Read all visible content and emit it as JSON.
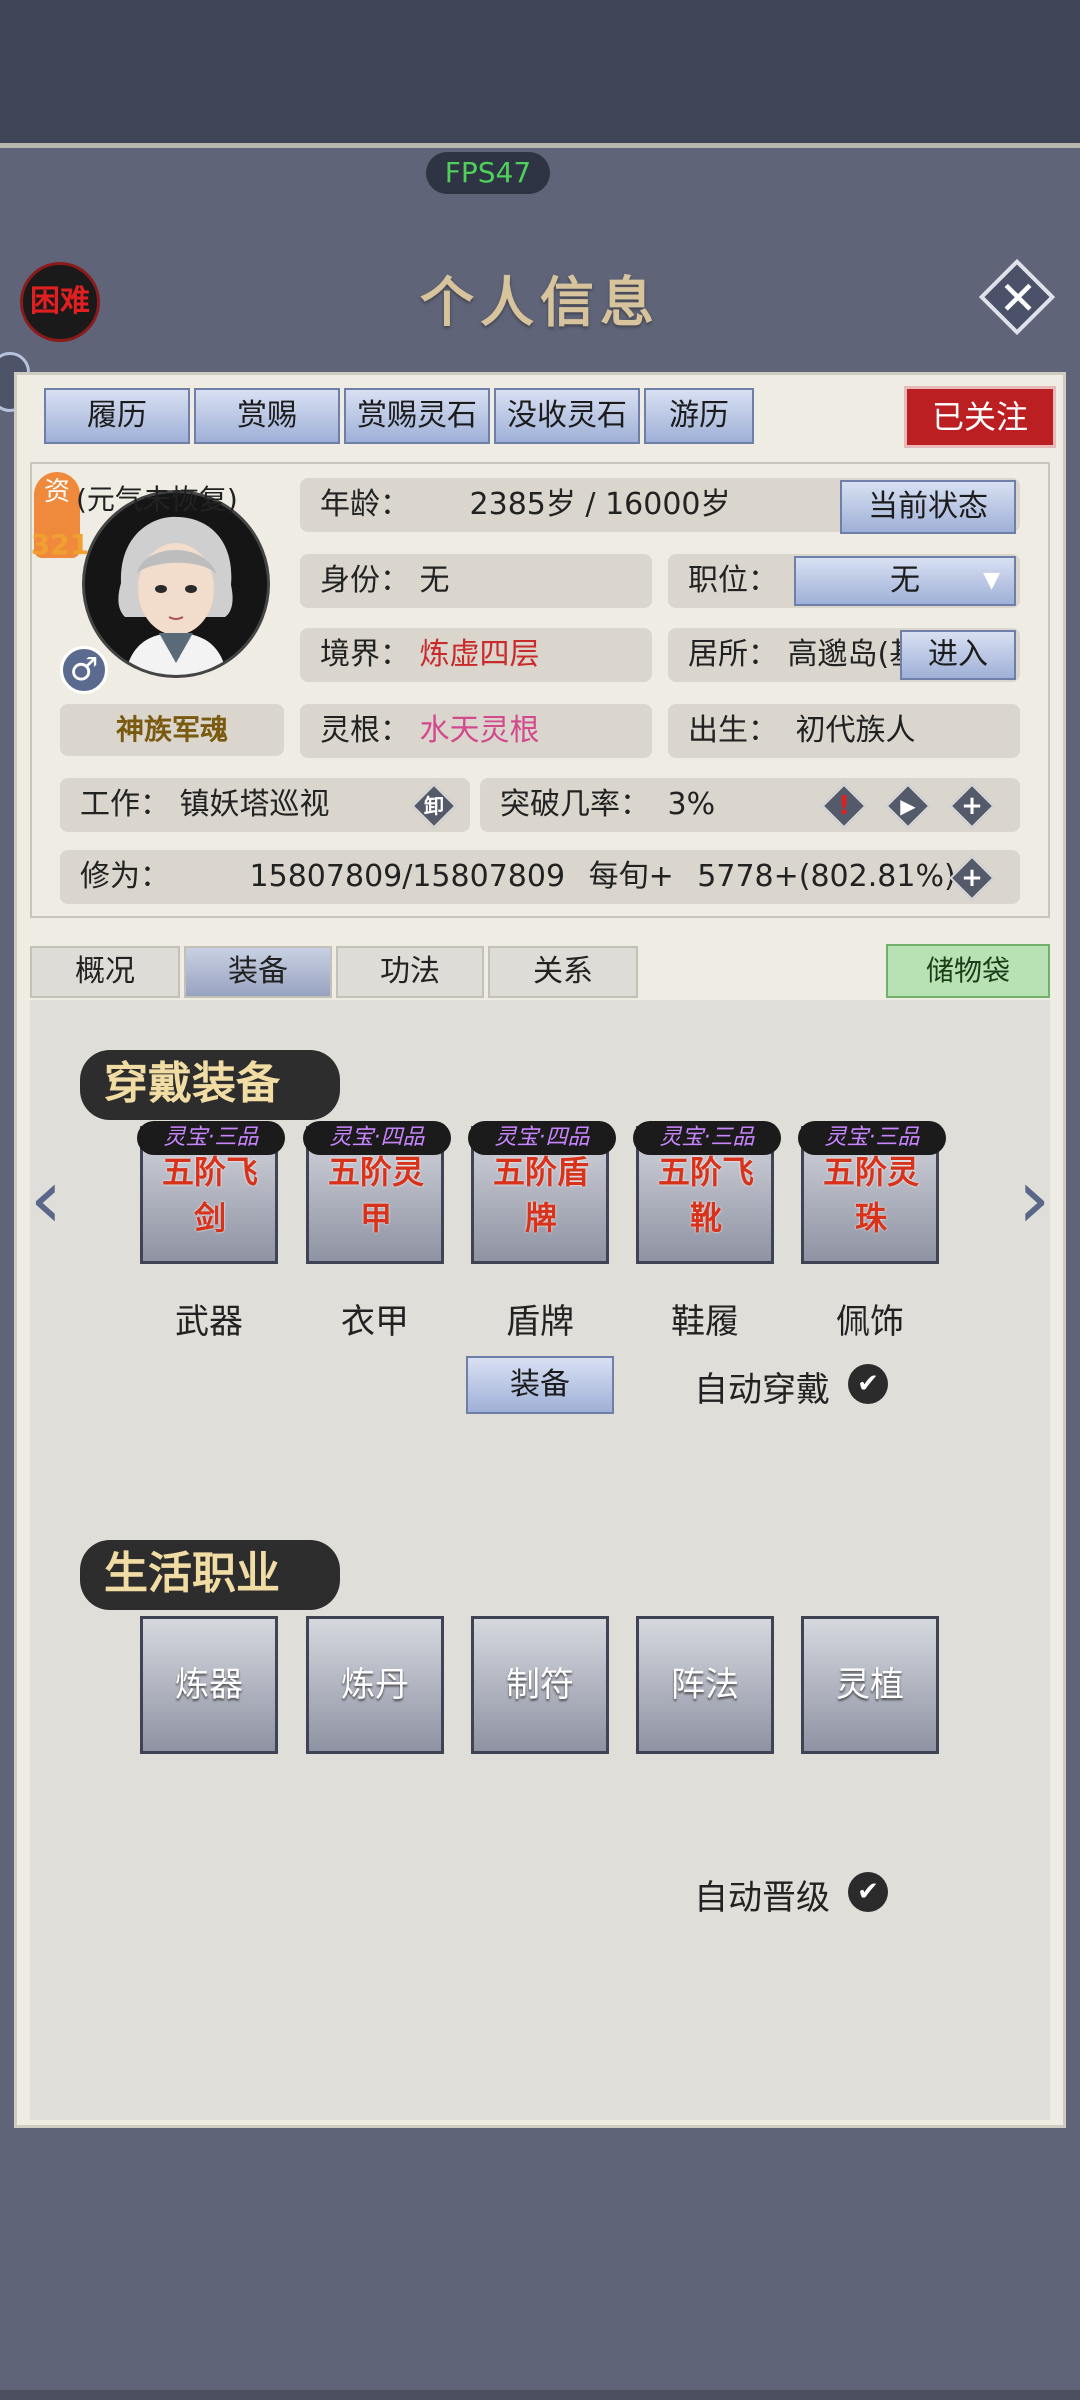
{
  "hud": {
    "fps": "FPS47"
  },
  "header": {
    "difficulty": "困难",
    "title": "个人信息",
    "close_icon": "close-icon"
  },
  "top_nav": {
    "tabs": [
      "履历",
      "赏赐",
      "赏赐灵石",
      "没收灵石",
      "游历"
    ],
    "followed": "已关注"
  },
  "profile": {
    "aptitude_label": "资",
    "aptitude_value": "321",
    "vigor_status": "(元气未恢复)",
    "gender_icon": "♂",
    "title_badge": "神族军魂",
    "age_label": "年龄：",
    "age_value": "2385岁 / 16000岁",
    "current_state_button": "当前状态",
    "identity_label": "身份：",
    "identity_value": "无",
    "position_label": "职位：",
    "position_value": "无",
    "realm_label": "境界：",
    "realm_value": "炼虚四层",
    "residence_label": "居所：",
    "residence_value": "高邈岛(基",
    "enter_button": "进入",
    "root_label": "灵根：",
    "root_value": "水天灵根",
    "birth_label": "出生：",
    "birth_value": "初代族人",
    "work_label": "工作：",
    "work_value": "镇妖塔巡视",
    "work_button": "卸",
    "breakthrough_label": "突破几率：",
    "breakthrough_value": "3%",
    "cultivation_label": "修为：",
    "cultivation_value": "15807809/15807809",
    "per_turn_label": "每旬+",
    "per_turn_value": "5778+(802.81%)"
  },
  "sub_tabs": {
    "tabs": [
      "概况",
      "装备",
      "功法",
      "关系"
    ],
    "active": "装备",
    "bag": "储物袋"
  },
  "equipment": {
    "section_title": "穿戴装备",
    "slots": [
      {
        "grade": "灵宝·三品",
        "item": "五阶飞剑",
        "label": "武器"
      },
      {
        "grade": "灵宝·四品",
        "item": "五阶灵甲",
        "label": "衣甲"
      },
      {
        "grade": "灵宝·四品",
        "item": "五阶盾牌",
        "label": "盾牌"
      },
      {
        "grade": "灵宝·三品",
        "item": "五阶飞靴",
        "label": "鞋履"
      },
      {
        "grade": "灵宝·三品",
        "item": "五阶灵珠",
        "label": "佩饰"
      }
    ],
    "equip_button": "装备",
    "auto_wear_label": "自动穿戴"
  },
  "life_jobs": {
    "section_title": "生活职业",
    "jobs": [
      "炼器",
      "炼丹",
      "制符",
      "阵法",
      "灵植"
    ],
    "auto_upgrade_label": "自动晋级"
  },
  "colors": {
    "accent_red": "#c92a2a",
    "root_pink": "#d24a8d",
    "nav_blue": "#9fb0d7",
    "bag_green": "#b8e2b4"
  }
}
